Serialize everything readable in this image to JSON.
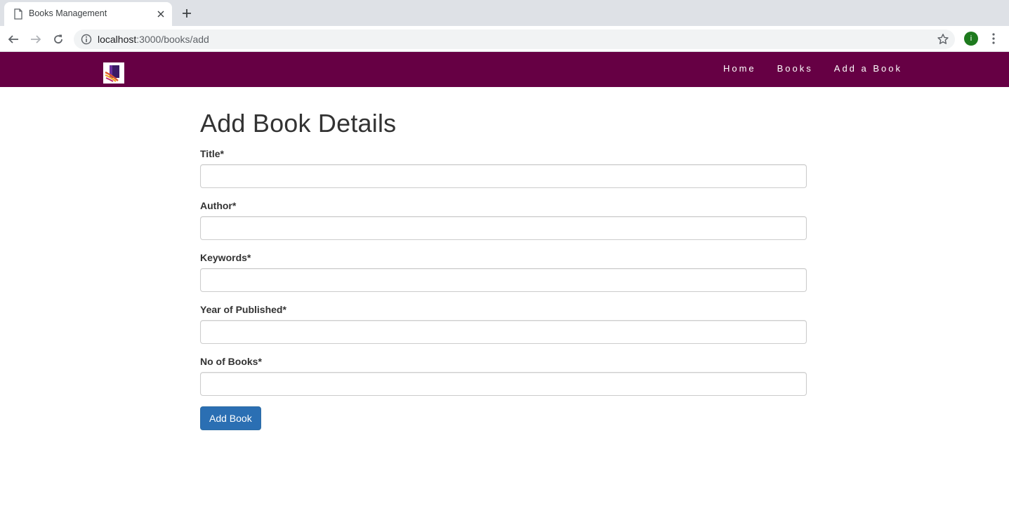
{
  "browser": {
    "tab_title": "Books Management",
    "url_host": "localhost",
    "url_path": ":3000/books/add",
    "profile_initial": "i"
  },
  "navbar": {
    "bg_color": "#660044",
    "links": [
      {
        "label": "Home"
      },
      {
        "label": "Books"
      },
      {
        "label": "Add a Book"
      }
    ]
  },
  "form": {
    "title": "Add Book Details",
    "fields": [
      {
        "label": "Title*",
        "value": ""
      },
      {
        "label": "Author*",
        "value": ""
      },
      {
        "label": "Keywords*",
        "value": ""
      },
      {
        "label": "Year of Published*",
        "value": ""
      },
      {
        "label": "No of Books*",
        "value": ""
      }
    ],
    "submit_label": "Add Book",
    "submit_color": "#2b6fb3"
  }
}
